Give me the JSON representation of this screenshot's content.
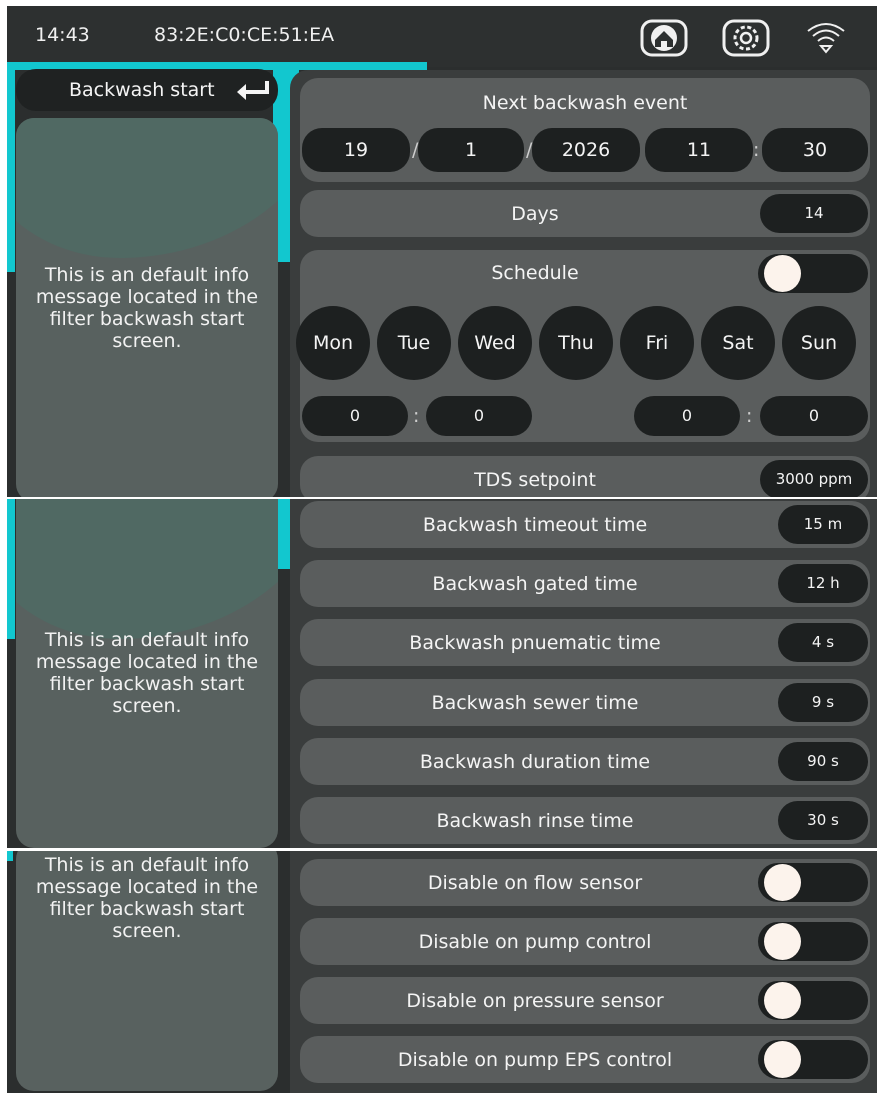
{
  "status_bar": {
    "time": "14:43",
    "device_id": "83:2E:C0:CE:51:EA"
  },
  "nav": {
    "back_label": "Backwash start"
  },
  "info_message": "This is an default info message located in the filter backwash start screen.",
  "next_event": {
    "title": "Next backwash event",
    "day": "19",
    "month": "1",
    "year": "2026",
    "hour": "11",
    "minute": "30",
    "sep_date": "/",
    "sep_time": ":"
  },
  "days": {
    "label": "Days",
    "value": "14"
  },
  "schedule": {
    "label": "Schedule",
    "enabled": false,
    "days": [
      "Mon",
      "Tue",
      "Wed",
      "Thu",
      "Fri",
      "Sat",
      "Sun"
    ],
    "start_hour": "0",
    "start_minute": "0",
    "end_hour": "0",
    "end_minute": "0",
    "sep": ":"
  },
  "tds": {
    "label": "TDS setpoint",
    "value": "3000 ppm"
  },
  "times": [
    {
      "label": "Backwash timeout time",
      "value": "15 m"
    },
    {
      "label": "Backwash gated time",
      "value": "12 h"
    },
    {
      "label": "Backwash pnuematic time",
      "value": "4 s"
    },
    {
      "label": "Backwash sewer time",
      "value": "9 s"
    },
    {
      "label": "Backwash duration time",
      "value": "90 s"
    },
    {
      "label": "Backwash rinse time",
      "value": "30 s"
    }
  ],
  "toggles": [
    {
      "label": "Disable on flow sensor",
      "enabled": false
    },
    {
      "label": "Disable on pump control",
      "enabled": false
    },
    {
      "label": "Disable on pressure sensor",
      "enabled": false
    },
    {
      "label": "Disable on pump EPS control",
      "enabled": false
    }
  ],
  "colors": {
    "accent": "#12c7cf",
    "background": "#2b2e2e",
    "row": "#5a5d5d",
    "pill": "#1d2020",
    "knob": "#fcf3ec"
  }
}
